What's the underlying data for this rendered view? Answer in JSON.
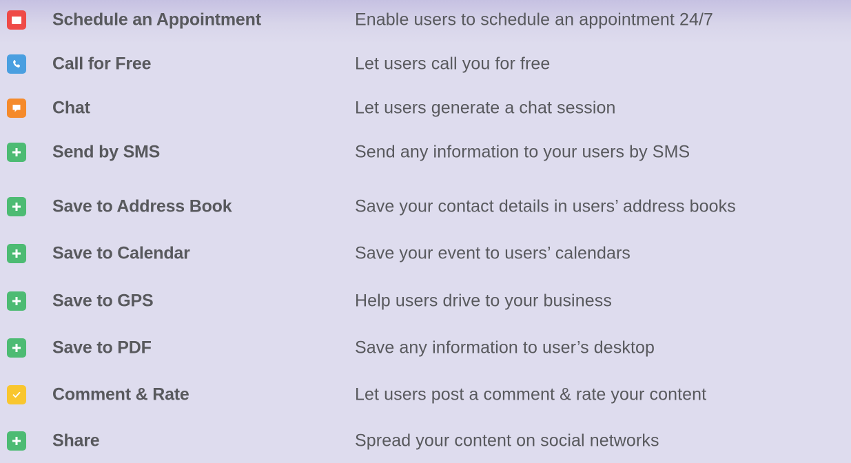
{
  "colors": {
    "background": "#dedcee",
    "text": "#58595d",
    "red": "#ef4a47",
    "blue": "#4a9fe0",
    "orange": "#f58a2b",
    "green": "#4dbb73",
    "yellow": "#f9c62e"
  },
  "features": [
    {
      "name": "Schedule an Appointment",
      "description": "Enable users to schedule an appointment 24/7",
      "icon": "calendar-icon",
      "icon_color": "#ef4a47"
    },
    {
      "name": "Call for Free",
      "description": "Let users call you for free",
      "icon": "phone-icon",
      "icon_color": "#4a9fe0"
    },
    {
      "name": "Chat",
      "description": "Let users generate a chat session",
      "icon": "chat-bubble-icon",
      "icon_color": "#f58a2b"
    },
    {
      "name": "Send by SMS",
      "description": "Send any information to your users by SMS",
      "icon": "plus-icon",
      "icon_color": "#4dbb73"
    },
    {
      "name": "Save to Address Book",
      "description": "Save your contact details in users’ address books",
      "icon": "plus-icon",
      "icon_color": "#4dbb73"
    },
    {
      "name": "Save to Calendar",
      "description": "Save your event to users’ calendars",
      "icon": "plus-icon",
      "icon_color": "#4dbb73"
    },
    {
      "name": "Save to GPS",
      "description": "Help users drive to your business",
      "icon": "plus-icon",
      "icon_color": "#4dbb73"
    },
    {
      "name": "Save to PDF",
      "description": "Save any information to user’s desktop",
      "icon": "plus-icon",
      "icon_color": "#4dbb73"
    },
    {
      "name": "Comment & Rate",
      "description": "Let users post a comment & rate your content",
      "icon": "checkmark-icon",
      "icon_color": "#f9c62e"
    },
    {
      "name": "Share",
      "description": "Spread your content on social networks",
      "icon": "plus-icon",
      "icon_color": "#4dbb73"
    }
  ]
}
